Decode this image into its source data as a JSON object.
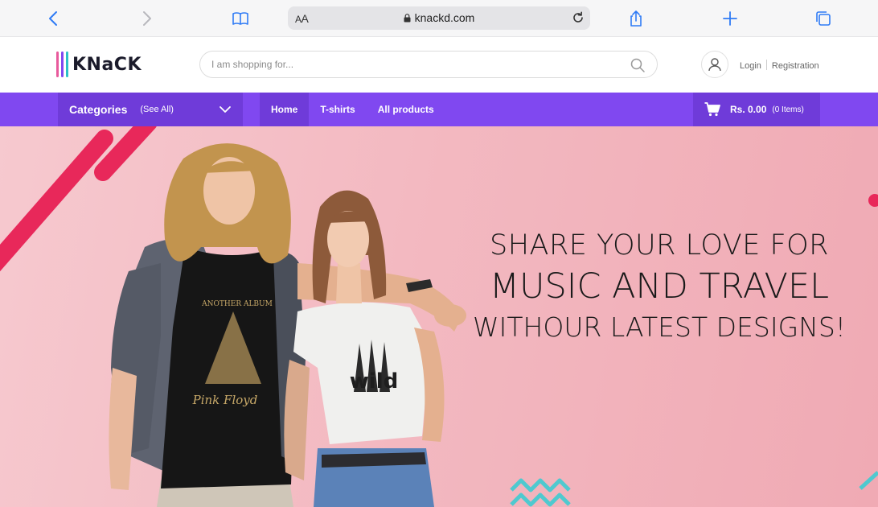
{
  "browser": {
    "text_size_label_small": "A",
    "text_size_label_big": "A",
    "url": "knackd.com"
  },
  "site": {
    "logo_text": "KNaCK",
    "logo_bar_colors": [
      "#e85a9c",
      "#8048f0",
      "#2bc0c8"
    ],
    "search_placeholder": "I am shopping for...",
    "login_label": "Login",
    "registration_label": "Registration"
  },
  "nav": {
    "categories_label": "Categories",
    "see_all_label": "(See All)",
    "links": [
      "Home",
      "T-shirts",
      "All products"
    ],
    "active_link": "Home",
    "cart_amount": "Rs. 0.00",
    "cart_items": "(0 Items)"
  },
  "hero": {
    "line1": "SHARE YOUR LOVE FOR",
    "line2": "MUSIC AND TRAVEL",
    "line3": "WITHOUR LATEST DESIGNS!",
    "shirt_text_left": "ANOTHER ALBUM",
    "shirt_text_left_script": "Pink Floyd",
    "shirt_text_right": "wild"
  },
  "colors": {
    "nav_purple": "#8048f0",
    "nav_purple_dark": "#6f3bd9",
    "hero_pink": "#f3b9c1",
    "accent_red": "#e8285a",
    "accent_teal": "#4fc9cf"
  }
}
